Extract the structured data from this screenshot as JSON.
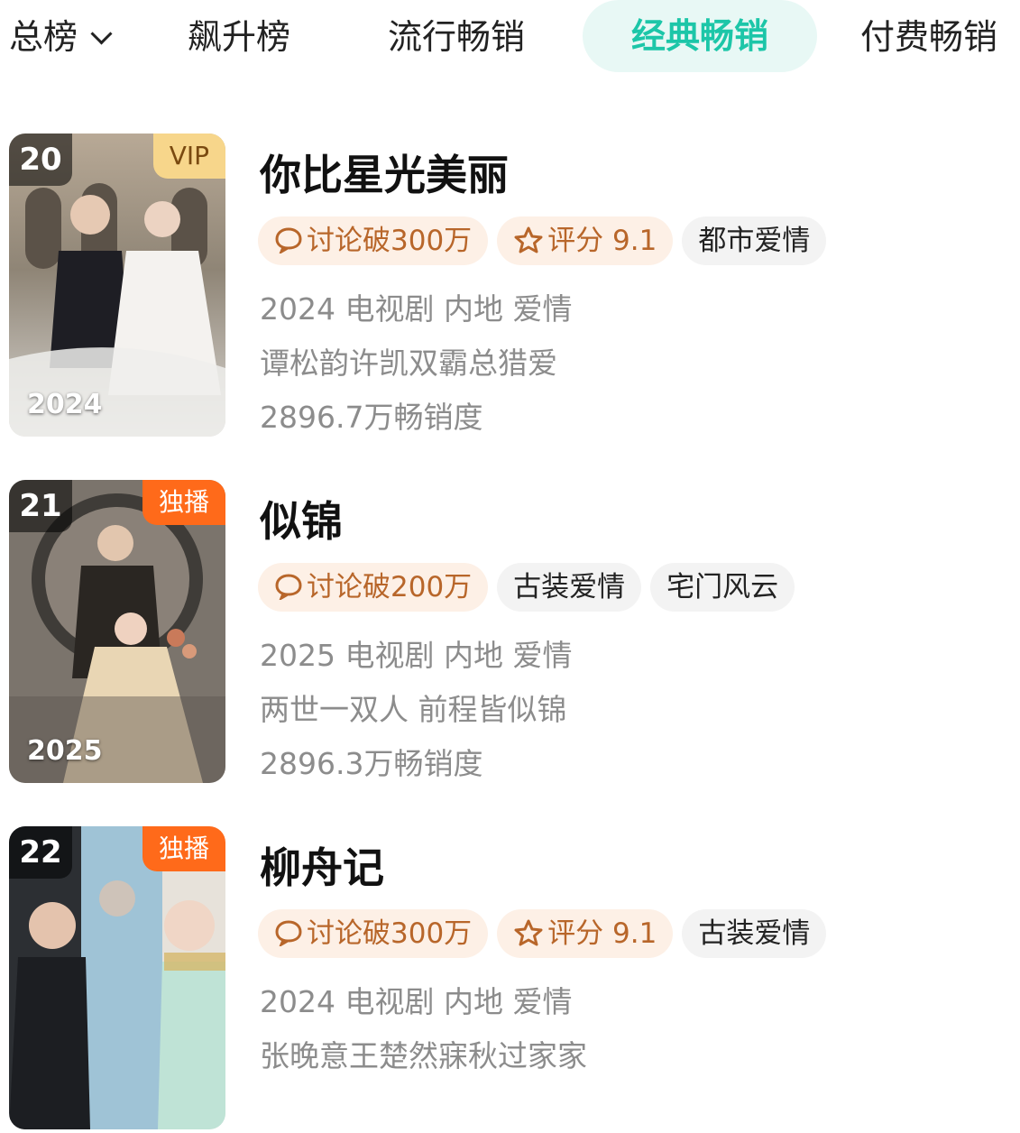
{
  "tabs": {
    "main": "总榜",
    "rising": "飙升榜",
    "popular": "流行畅销",
    "classic": "经典畅销",
    "paid": "付费畅销"
  },
  "items": [
    {
      "rank": "20",
      "badge": "VIP",
      "year": "2024",
      "title": "你比星光美丽",
      "discussion": "讨论破300万",
      "rating": "评分 9.1",
      "tags": [
        "都市爱情"
      ],
      "meta": "2024 电视剧 内地 爱情",
      "desc": "谭松韵许凯双霸总猎爱",
      "sales": "2896.7万畅销度"
    },
    {
      "rank": "21",
      "badge": "独播",
      "year": "2025",
      "title": "似锦",
      "discussion": "讨论破200万",
      "tags": [
        "古装爱情",
        "宅门风云"
      ],
      "meta": "2025 电视剧 内地 爱情",
      "desc": "两世一双人 前程皆似锦",
      "sales": "2896.3万畅销度"
    },
    {
      "rank": "22",
      "badge": "独播",
      "title": "柳舟记",
      "discussion": "讨论破300万",
      "rating": "评分 9.1",
      "tags": [
        "古装爱情"
      ],
      "meta": "2024 电视剧 内地 爱情",
      "desc": "张晚意王楚然寐秋过家家"
    }
  ],
  "colors": {
    "accent": "#1cc6a8",
    "accent_bg": "#e8f8f5",
    "hot_tag_bg": "#fdf0e6",
    "hot_tag_text": "#b8662a",
    "vip_badge": "#f7d68b",
    "exclusive_badge": "#ff6a1a"
  },
  "icons": {
    "discussion": "speech-bubble-icon",
    "rating": "star-icon",
    "dropdown": "chevron-down-icon"
  }
}
